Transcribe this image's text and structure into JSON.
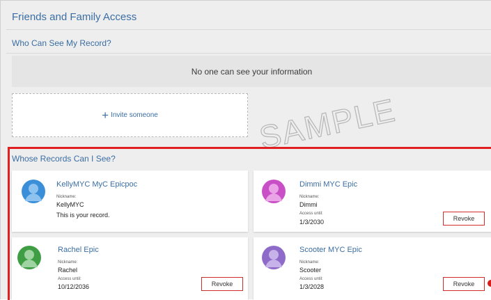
{
  "header": {
    "title": "Friends and Family Access"
  },
  "who_can_see": {
    "title": "Who Can See My Record?",
    "empty_message": "No one can see your information",
    "invite_label": "Invite someone"
  },
  "watermark": "SAMPLE",
  "whose_records": {
    "title": "Whose Records Can I See?",
    "cards": [
      {
        "name": "KellyMYC MyC Epicpoc",
        "nickname_label": "Nickname:",
        "nickname": "KellyMYC",
        "note": "This is your record.",
        "avatar_color": "#3a8fd8"
      },
      {
        "name": "Dimmi MYC Epic",
        "nickname_label": "Nickname:",
        "nickname": "Dimmi",
        "access_label": "Access until:",
        "access_until": "1/3/2030",
        "revoke_label": "Revoke",
        "avatar_color": "#c94fc6"
      },
      {
        "name": "Rachel Epic",
        "nickname_label": "Nickname:",
        "nickname": "Rachel",
        "access_label": "Access until:",
        "access_until": "10/12/2036",
        "revoke_label": "Revoke",
        "avatar_color": "#3f9e44"
      },
      {
        "name": "Scooter MYC Epic",
        "nickname_label": "Nickname:",
        "nickname": "Scooter",
        "access_label": "Access until:",
        "access_until": "1/3/2028",
        "revoke_label": "Revoke",
        "avatar_color": "#8e6bc9"
      }
    ]
  }
}
